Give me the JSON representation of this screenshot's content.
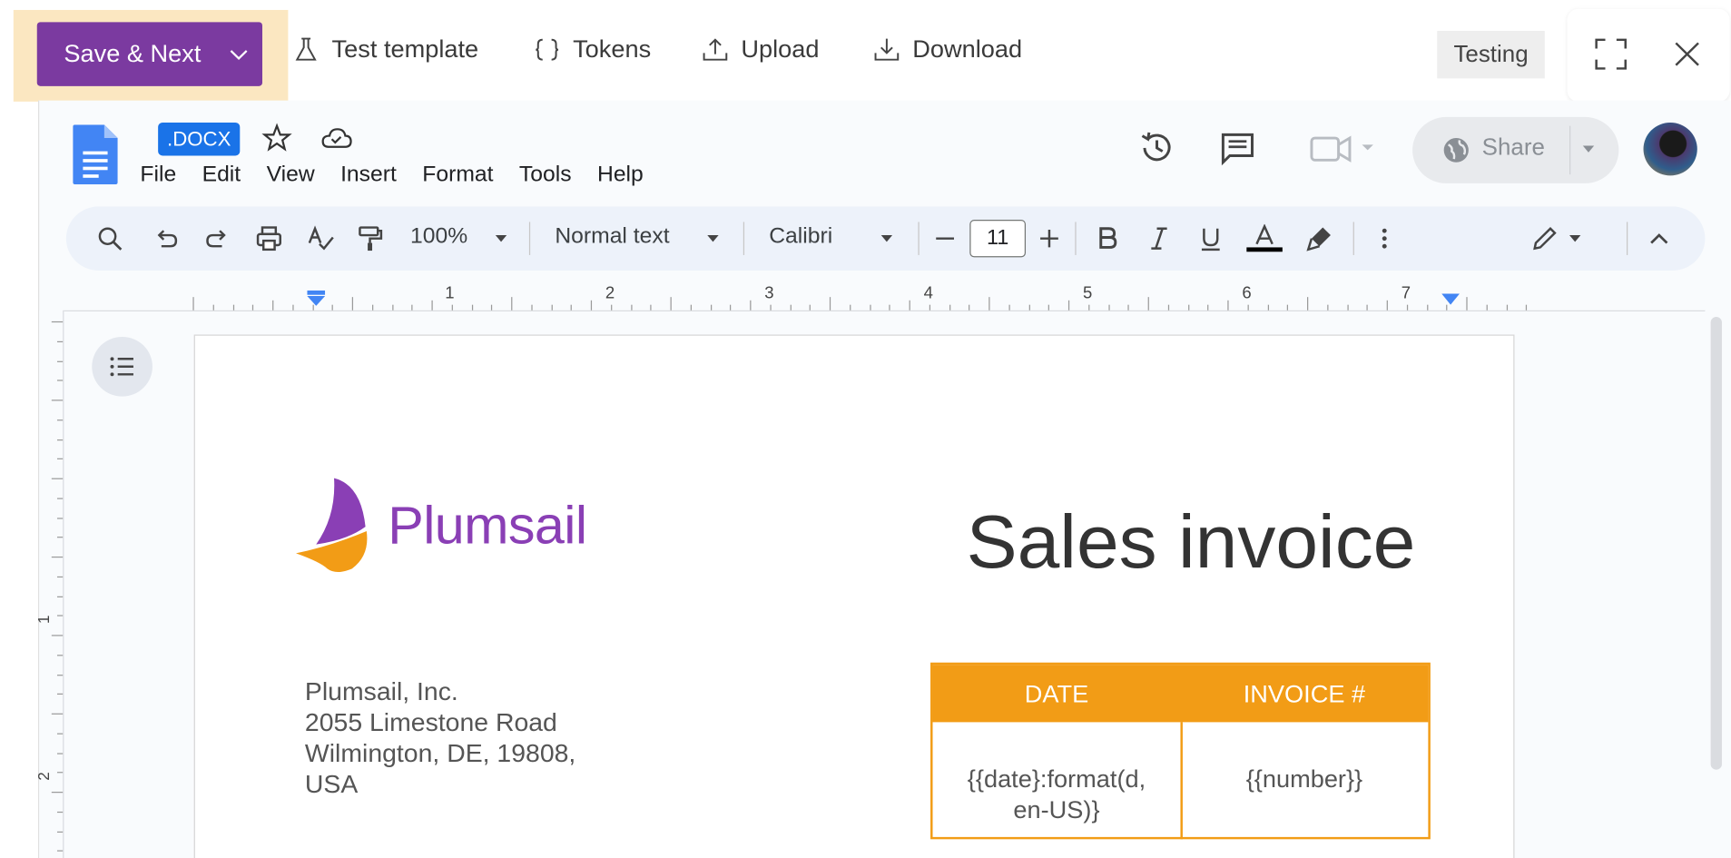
{
  "toolbar": {
    "save_next": "Save & Next",
    "test_template": "Test template",
    "tokens": "Tokens",
    "upload": "Upload",
    "download": "Download",
    "environment_badge": "Testing"
  },
  "docs": {
    "file_badge": ".DOCX",
    "menu": [
      "File",
      "Edit",
      "View",
      "Insert",
      "Format",
      "Tools",
      "Help"
    ],
    "share_label": "Share"
  },
  "format_toolbar": {
    "zoom": "100%",
    "style": "Normal text",
    "font": "Calibri",
    "font_size": "11"
  },
  "ruler": {
    "h_numbers": [
      "1",
      "2",
      "3",
      "4",
      "5",
      "6",
      "7"
    ],
    "v_numbers": [
      "1",
      "2"
    ]
  },
  "document": {
    "logo_text": "Plumsail",
    "title": "Sales invoice",
    "address": [
      "Plumsail, Inc.",
      "2055 Limestone Road",
      "Wilmington, DE, 19808,",
      "USA"
    ],
    "table": {
      "headers": [
        "DATE",
        "INVOICE #"
      ],
      "cells": [
        "{{date}:format(d,\nen-US)}",
        "{{number}}"
      ]
    }
  },
  "colors": {
    "brand_purple": "#7b3aa0",
    "save_highlight": "#fbe7c1",
    "accent_orange": "#f29c16",
    "docs_blue": "#1a73e8"
  }
}
